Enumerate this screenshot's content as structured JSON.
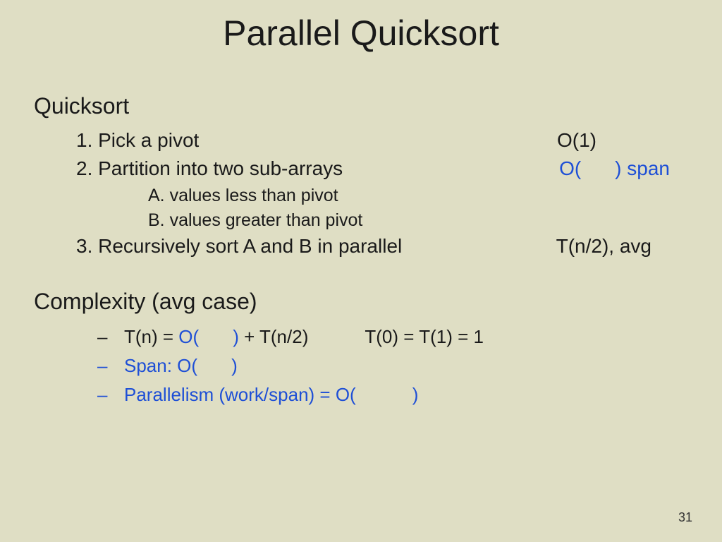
{
  "title": "Parallel Quicksort",
  "quicksort": {
    "heading": "Quicksort",
    "step1": {
      "label": "1. Pick a pivot",
      "cost": "O(1)"
    },
    "step2": {
      "label": "2. Partition into two sub-arrays",
      "cost_pre": "O(",
      "cost_post": ") span"
    },
    "subA": "A. values less than pivot",
    "subB": "B. values greater than pivot",
    "step3": {
      "label": "3. Recursively sort A and B in parallel",
      "cost": "T(n/2), avg"
    }
  },
  "complexity": {
    "heading": "Complexity (avg case)",
    "line1": {
      "pre": "T(n) = ",
      "blue_pre": "O(",
      "blue_post": ")",
      "mid": " + T(n/2)",
      "base": "T(0) = T(1) = 1"
    },
    "line2": {
      "pre": "Span:  O(",
      "post": ")"
    },
    "line3": {
      "pre": "Parallelism (work/span) = O(",
      "post": ")"
    }
  },
  "page": "31"
}
